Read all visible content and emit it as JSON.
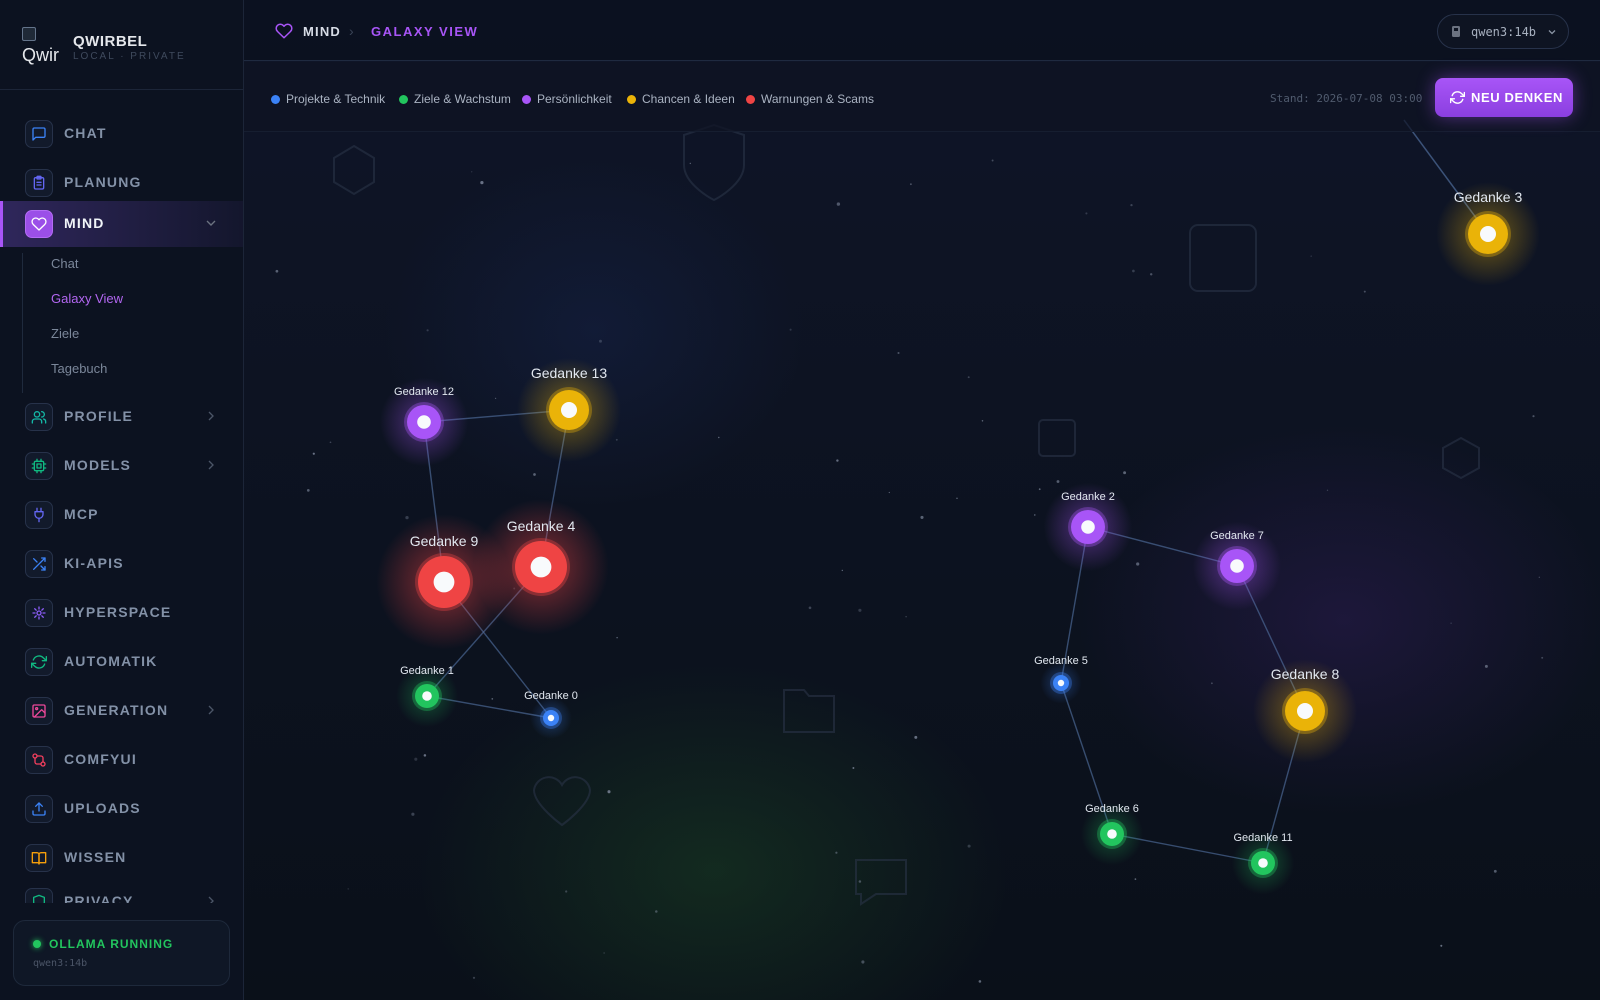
{
  "brand": {
    "logo_text": "Qwir",
    "name": "QWIRBEL",
    "subtitle": "LOCAL · PRIVATE"
  },
  "sidebar": {
    "items": [
      {
        "label": "CHAT",
        "icon": "chat-icon",
        "color": "#3b82f6"
      },
      {
        "label": "PLANUNG",
        "icon": "clipboard-icon",
        "color": "#6366f1"
      },
      {
        "label": "MIND",
        "icon": "heart-icon",
        "color": "#a855f7",
        "active": true,
        "expanded": true
      },
      {
        "label": "PROFILE",
        "icon": "users-icon",
        "color": "#14b8a6",
        "has_children": true
      },
      {
        "label": "MODELS",
        "icon": "cpu-icon",
        "color": "#10b981",
        "has_children": true
      },
      {
        "label": "MCP",
        "icon": "plug-icon",
        "color": "#6366f1"
      },
      {
        "label": "KI-APIS",
        "icon": "shuffle-icon",
        "color": "#3b82f6"
      },
      {
        "label": "HYPERSPACE",
        "icon": "sparkle-icon",
        "color": "#8b5cf6"
      },
      {
        "label": "AUTOMATIK",
        "icon": "refresh-icon",
        "color": "#10b981"
      },
      {
        "label": "GENERATION",
        "icon": "image-icon",
        "color": "#ec4899",
        "has_children": true
      },
      {
        "label": "COMFYUI",
        "icon": "workflow-icon",
        "color": "#f43f5e"
      },
      {
        "label": "UPLOADS",
        "icon": "upload-icon",
        "color": "#3b82f6"
      },
      {
        "label": "WISSEN",
        "icon": "book-icon",
        "color": "#f59e0b"
      },
      {
        "label": "PRIVACY",
        "icon": "shield-icon",
        "color": "#10b981",
        "has_children": true
      }
    ],
    "mind_sub_items": [
      {
        "label": "Chat"
      },
      {
        "label": "Galaxy View",
        "active": true
      },
      {
        "label": "Ziele"
      },
      {
        "label": "Tagebuch"
      }
    ]
  },
  "status": {
    "title": "OLLAMA RUNNING",
    "model": "qwen3:14b",
    "color": "#22c55e"
  },
  "header": {
    "breadcrumb_root": "MIND",
    "breadcrumb_current": "GALAXY VIEW",
    "model_selector": "qwen3:14b"
  },
  "legend": [
    {
      "label": "Projekte & Technik",
      "color": "#3b82f6"
    },
    {
      "label": "Ziele & Wachstum",
      "color": "#22c55e"
    },
    {
      "label": "Persönlichkeit",
      "color": "#a855f7"
    },
    {
      "label": "Chancen & Ideen",
      "color": "#eab308"
    },
    {
      "label": "Warnungen & Scams",
      "color": "#ef4444"
    }
  ],
  "stand_text": "Stand: 2026-07-08 03:00",
  "rethink_button": "NEU DENKEN",
  "nodes": [
    {
      "id": 0,
      "label": "Gedanke 0",
      "category": "Projekte & Technik",
      "color": "#3b82f6",
      "importance": 1
    },
    {
      "id": 1,
      "label": "Gedanke 1",
      "category": "Ziele & Wachstum",
      "color": "#22c55e",
      "importance": 2
    },
    {
      "id": 2,
      "label": "Gedanke 2",
      "category": "Persönlichkeit",
      "color": "#a855f7",
      "importance": 3
    },
    {
      "id": 3,
      "label": "Gedanke 3",
      "category": "Chancen & Ideen",
      "color": "#eab308",
      "importance": 4
    },
    {
      "id": 4,
      "label": "Gedanke 4",
      "category": "Warnungen & Scams",
      "color": "#ef4444",
      "importance": 5
    },
    {
      "id": 5,
      "label": "Gedanke 5",
      "category": "Projekte & Technik",
      "color": "#3b82f6",
      "importance": 1
    },
    {
      "id": 6,
      "label": "Gedanke 6",
      "category": "Ziele & Wachstum",
      "color": "#22c55e",
      "importance": 2
    },
    {
      "id": 7,
      "label": "Gedanke 7",
      "category": "Persönlichkeit",
      "color": "#a855f7",
      "importance": 3
    },
    {
      "id": 8,
      "label": "Gedanke 8",
      "category": "Chancen & Ideen",
      "color": "#eab308",
      "importance": 4
    },
    {
      "id": 9,
      "label": "Gedanke 9",
      "category": "Warnungen & Scams",
      "color": "#ef4444",
      "importance": 5
    },
    {
      "id": 11,
      "label": "Gedanke 11",
      "category": "Ziele & Wachstum",
      "color": "#22c55e",
      "importance": 2
    },
    {
      "id": 12,
      "label": "Gedanke 12",
      "category": "Persönlichkeit",
      "color": "#a855f7",
      "importance": 3
    },
    {
      "id": 13,
      "label": "Gedanke 13",
      "category": "Chancen & Ideen",
      "color": "#eab308",
      "importance": 4
    }
  ],
  "edges": [
    [
      12,
      13
    ],
    [
      12,
      9
    ],
    [
      13,
      4
    ],
    [
      9,
      0
    ],
    [
      4,
      1
    ],
    [
      1,
      0
    ],
    [
      2,
      7
    ],
    [
      2,
      5
    ],
    [
      7,
      8
    ],
    [
      5,
      6
    ],
    [
      6,
      11
    ],
    [
      8,
      11
    ]
  ]
}
